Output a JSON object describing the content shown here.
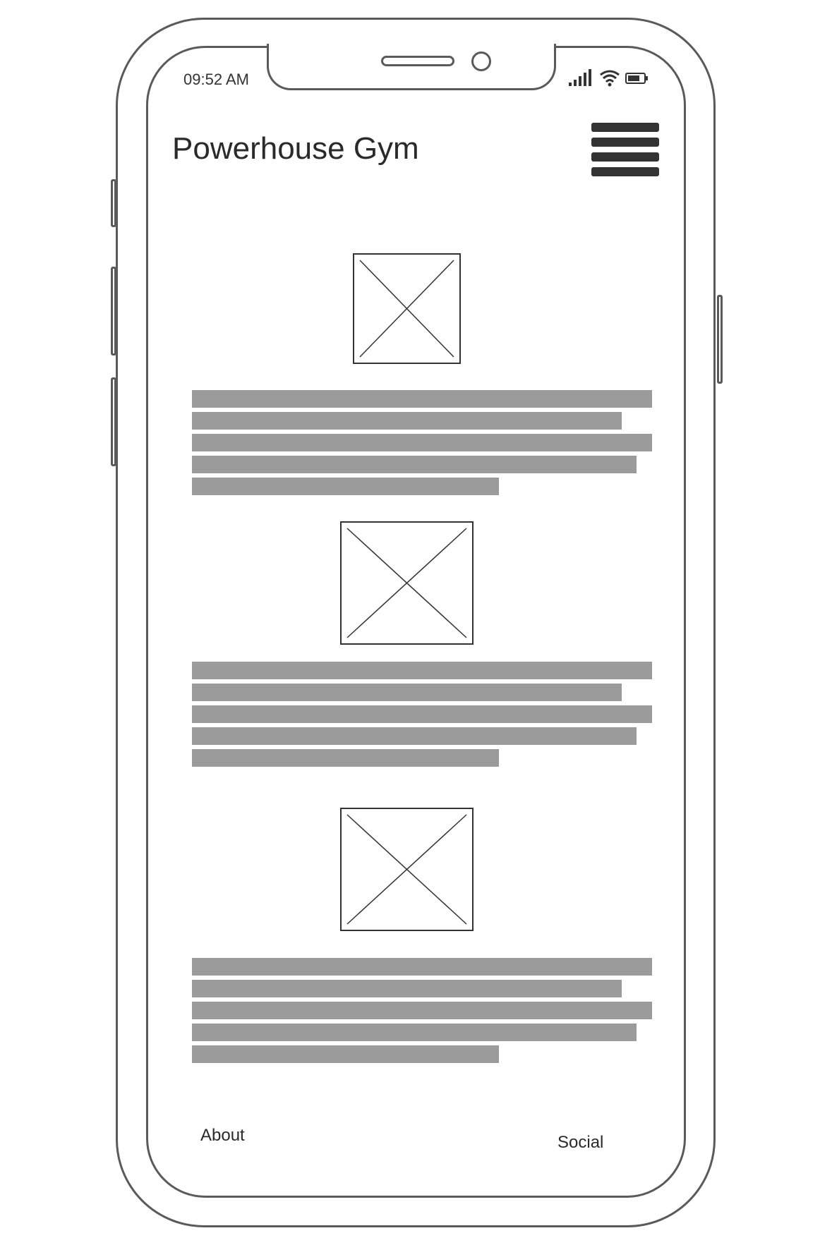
{
  "status_bar": {
    "time": "09:52 AM",
    "icons": [
      "signal-icon",
      "wifi-icon",
      "battery-icon"
    ]
  },
  "header": {
    "title": "Powerhouse Gym",
    "menu_icon": "hamburger-menu-icon"
  },
  "content": {
    "sections": [
      {
        "image": "image-placeholder-icon",
        "paragraph_lines": 5
      },
      {
        "image": "image-placeholder-icon",
        "paragraph_lines": 5
      },
      {
        "image": "image-placeholder-icon",
        "paragraph_lines": 5
      }
    ]
  },
  "footer": {
    "about_label": "About",
    "social_label": "Social"
  },
  "colors": {
    "outline": "#5a5a5a",
    "text_placeholder": "#9b9b9b",
    "text": "#2a2a2a"
  }
}
